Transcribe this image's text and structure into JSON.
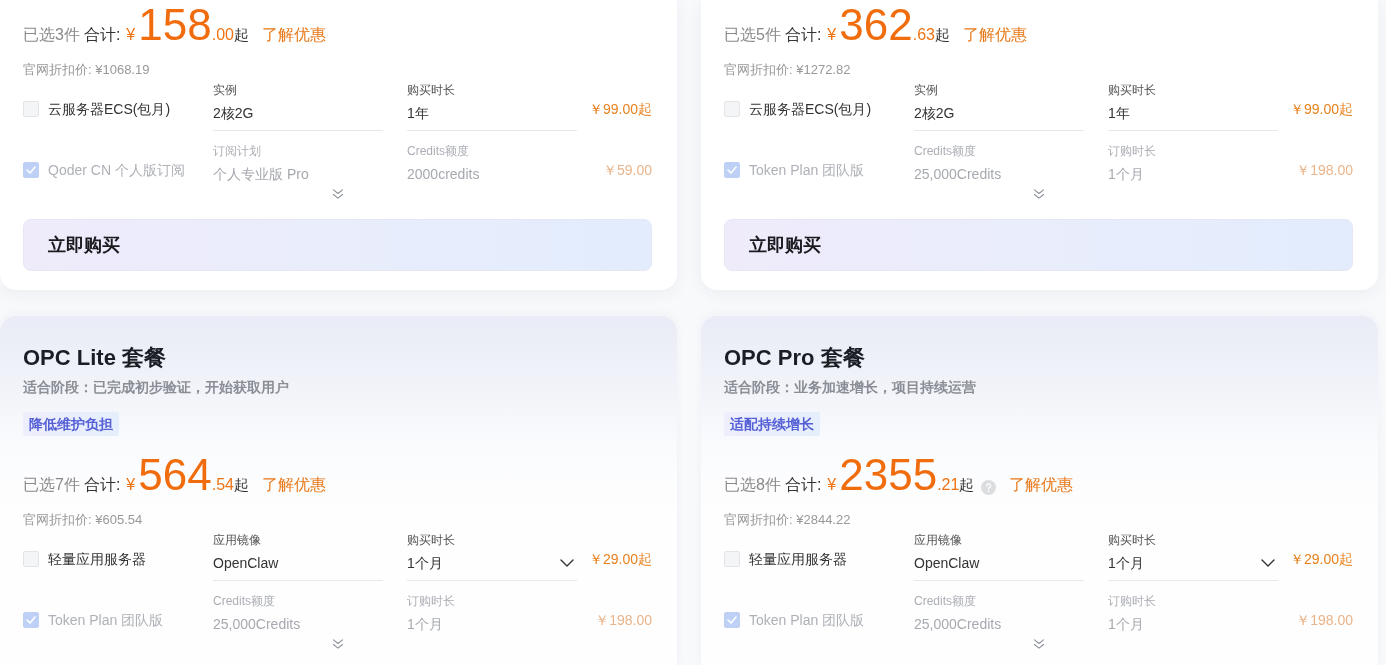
{
  "plans": [
    {
      "summary": {
        "count": "已选3件",
        "total_label": "合计:",
        "currency": "¥",
        "integer": "158",
        "decimal": ".00",
        "suffix": "起",
        "offer_link": "了解优惠"
      },
      "list_price": "官网折扣价: ¥1068.19",
      "items": [
        {
          "name": "云服务器ECS(包月)",
          "checked": false,
          "disabled": false,
          "fields": [
            {
              "label": "实例",
              "value": "2核2G",
              "dropdown": false
            },
            {
              "label": "购买时长",
              "value": "1年",
              "dropdown": false
            }
          ],
          "price": "￥99.00起"
        },
        {
          "name": "Qoder CN 个人版订阅",
          "checked": true,
          "disabled": true,
          "fields": [
            {
              "label": "订阅计划",
              "value": "个人专业版 Pro",
              "dropdown": false
            },
            {
              "label": "Credits额度",
              "value": "2000credits",
              "dropdown": false
            }
          ],
          "price": "￥59.00"
        }
      ],
      "buy_button": "立即购买"
    },
    {
      "summary": {
        "count": "已选5件",
        "total_label": "合计:",
        "currency": "¥",
        "integer": "362",
        "decimal": ".63",
        "suffix": "起",
        "offer_link": "了解优惠"
      },
      "list_price": "官网折扣价: ¥1272.82",
      "items": [
        {
          "name": "云服务器ECS(包月)",
          "checked": false,
          "disabled": false,
          "fields": [
            {
              "label": "实例",
              "value": "2核2G",
              "dropdown": false
            },
            {
              "label": "购买时长",
              "value": "1年",
              "dropdown": false
            }
          ],
          "price": "￥99.00起"
        },
        {
          "name": "Token Plan 团队版",
          "checked": true,
          "disabled": true,
          "fields": [
            {
              "label": "Credits额度",
              "value": "25,000Credits",
              "dropdown": false
            },
            {
              "label": "订购时长",
              "value": "1个月",
              "dropdown": false
            }
          ],
          "price": "￥198.00"
        }
      ],
      "buy_button": "立即购买"
    },
    {
      "title": "OPC Lite 套餐",
      "stage": "适合阶段：已完成初步验证，开始获取用户",
      "tag": "降低维护负担",
      "summary": {
        "count": "已选7件",
        "total_label": "合计:",
        "currency": "¥",
        "integer": "564",
        "decimal": ".54",
        "suffix": "起",
        "offer_link": "了解优惠"
      },
      "list_price": "官网折扣价: ¥605.54",
      "items": [
        {
          "name": "轻量应用服务器",
          "checked": false,
          "disabled": false,
          "fields": [
            {
              "label": "应用镜像",
              "value": "OpenClaw",
              "dropdown": false
            },
            {
              "label": "购买时长",
              "value": "1个月",
              "dropdown": true
            }
          ],
          "price": "￥29.00起"
        },
        {
          "name": "Token Plan 团队版",
          "checked": true,
          "disabled": true,
          "fields": [
            {
              "label": "Credits额度",
              "value": "25,000Credits",
              "dropdown": false
            },
            {
              "label": "订购时长",
              "value": "1个月",
              "dropdown": false
            }
          ],
          "price": "￥198.00"
        }
      ]
    },
    {
      "title": "OPC Pro 套餐",
      "stage": "适合阶段：业务加速增长，项目持续运营",
      "tag": "适配持续增长",
      "summary": {
        "count": "已选8件",
        "total_label": "合计:",
        "currency": "¥",
        "integer": "2355",
        "decimal": ".21",
        "suffix": "起",
        "help_icon": true,
        "offer_link": "了解优惠"
      },
      "list_price": "官网折扣价: ¥2844.22",
      "items": [
        {
          "name": "轻量应用服务器",
          "checked": false,
          "disabled": false,
          "fields": [
            {
              "label": "应用镜像",
              "value": "OpenClaw",
              "dropdown": false
            },
            {
              "label": "购买时长",
              "value": "1个月",
              "dropdown": true
            }
          ],
          "price": "￥29.00起"
        },
        {
          "name": "Token Plan 团队版",
          "checked": true,
          "disabled": true,
          "fields": [
            {
              "label": "Credits额度",
              "value": "25,000Credits",
              "dropdown": false
            },
            {
              "label": "订购时长",
              "value": "1个月",
              "dropdown": false
            }
          ],
          "price": "￥198.00"
        }
      ]
    }
  ]
}
